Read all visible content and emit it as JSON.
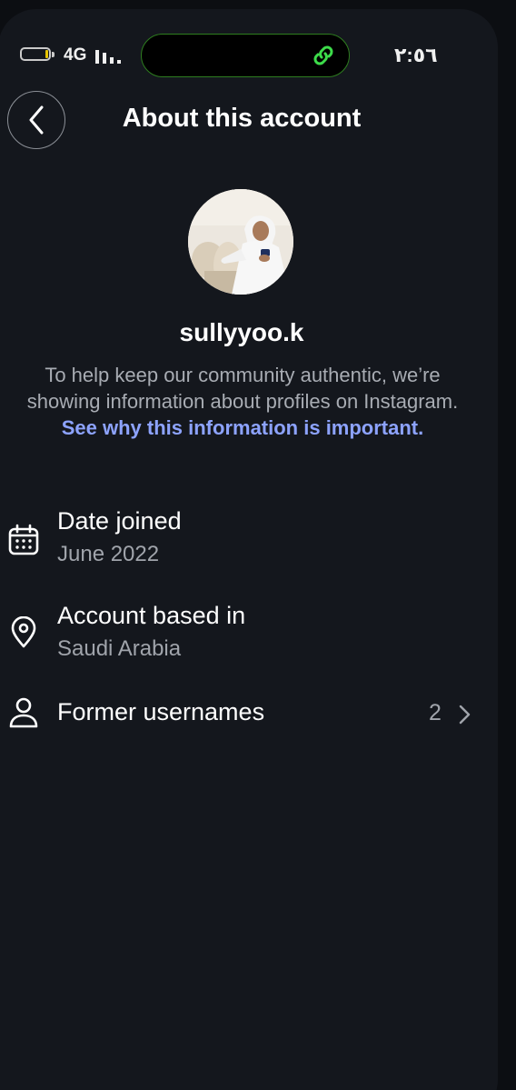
{
  "status_bar": {
    "network": "4G",
    "time": "٢:٥٦",
    "battery_level_percent": 10
  },
  "header": {
    "title": "About this account",
    "back_icon": "chevron-left-icon"
  },
  "profile": {
    "username": "sullyyoo.k",
    "description_text": "To help keep our community authentic, we’re showing information about profiles on Instagram. ",
    "description_link": "See why this information is important."
  },
  "info_rows": [
    {
      "icon": "calendar-icon",
      "label": "Date joined",
      "value": "June 2022"
    },
    {
      "icon": "location-pin-icon",
      "label": "Account based in",
      "value": "Saudi Arabia"
    },
    {
      "icon": "person-icon",
      "label": "Former usernames",
      "count": "2"
    }
  ],
  "colors": {
    "background": "#14171d",
    "link": "#8da3ff",
    "secondary_text": "#a8acb3"
  }
}
